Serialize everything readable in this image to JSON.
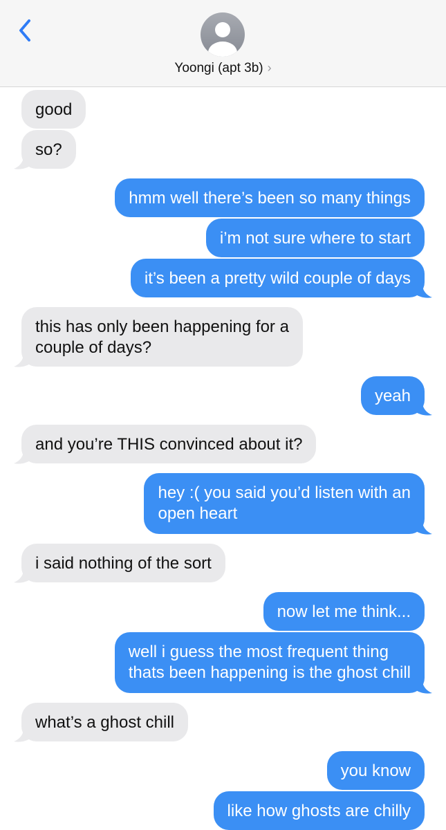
{
  "header": {
    "contact_name": "Yoongi (apt 3b)",
    "chevron": "›",
    "back_icon": "chevron-left-icon",
    "avatar_icon": "person-silhouette-icon"
  },
  "colors": {
    "incoming_bubble": "#e9e9eb",
    "outgoing_bubble": "#3b8ff4",
    "accent": "#2f7cf6"
  },
  "messages": [
    {
      "from": "them",
      "text": "good"
    },
    {
      "from": "them",
      "text": "so?"
    },
    {
      "from": "me",
      "text": "hmm well there’s been so many things"
    },
    {
      "from": "me",
      "text": "i’m not sure where to start"
    },
    {
      "from": "me",
      "text": "it’s been a pretty wild couple of days"
    },
    {
      "from": "them",
      "text": "this has only been happening for a\ncouple of days?"
    },
    {
      "from": "me",
      "text": "yeah"
    },
    {
      "from": "them",
      "text": "and you’re THIS convinced about it?"
    },
    {
      "from": "me",
      "text": "hey :( you said you’d listen with an\nopen heart"
    },
    {
      "from": "them",
      "text": "i said nothing of the sort"
    },
    {
      "from": "me",
      "text": "now let me think..."
    },
    {
      "from": "me",
      "text": "well i guess the most frequent thing\nthats been happening is the ghost chill"
    },
    {
      "from": "them",
      "text": "what’s a ghost chill"
    },
    {
      "from": "me",
      "text": "you know"
    },
    {
      "from": "me",
      "text": "like how ghosts are chilly"
    }
  ]
}
